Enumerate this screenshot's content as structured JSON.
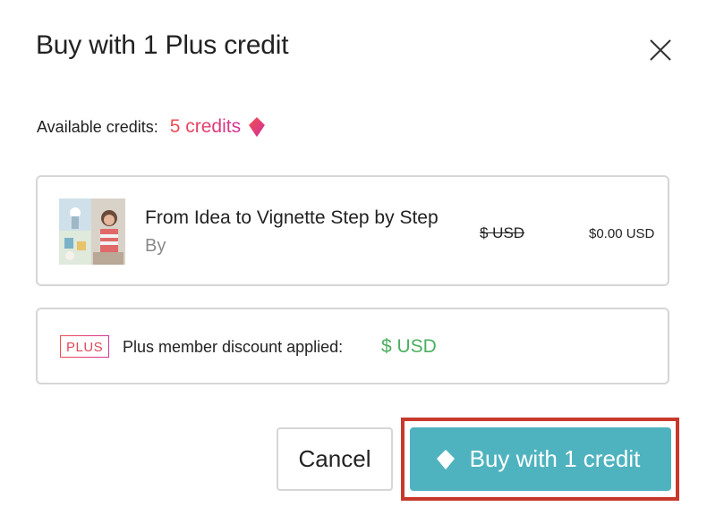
{
  "dialog": {
    "title": "Buy with 1 Plus credit"
  },
  "credits": {
    "label": "Available credits:",
    "value": "5 credits",
    "icon": "credit-gem-icon",
    "gradient_start": "#f04e4e",
    "gradient_end": "#d0339a"
  },
  "product": {
    "title": "From Idea to Vignette Step by Step",
    "by_label": "By",
    "original_price": "$      USD",
    "new_price": "$0.00 USD"
  },
  "discount": {
    "badge": "PLUS",
    "text": "Plus member discount applied:",
    "amount": "$      USD",
    "amount_color": "#4caf60"
  },
  "actions": {
    "cancel_label": "Cancel",
    "buy_label": "Buy with 1 credit",
    "buy_color": "#4fb3bf",
    "highlight_color": "#c8392b"
  }
}
